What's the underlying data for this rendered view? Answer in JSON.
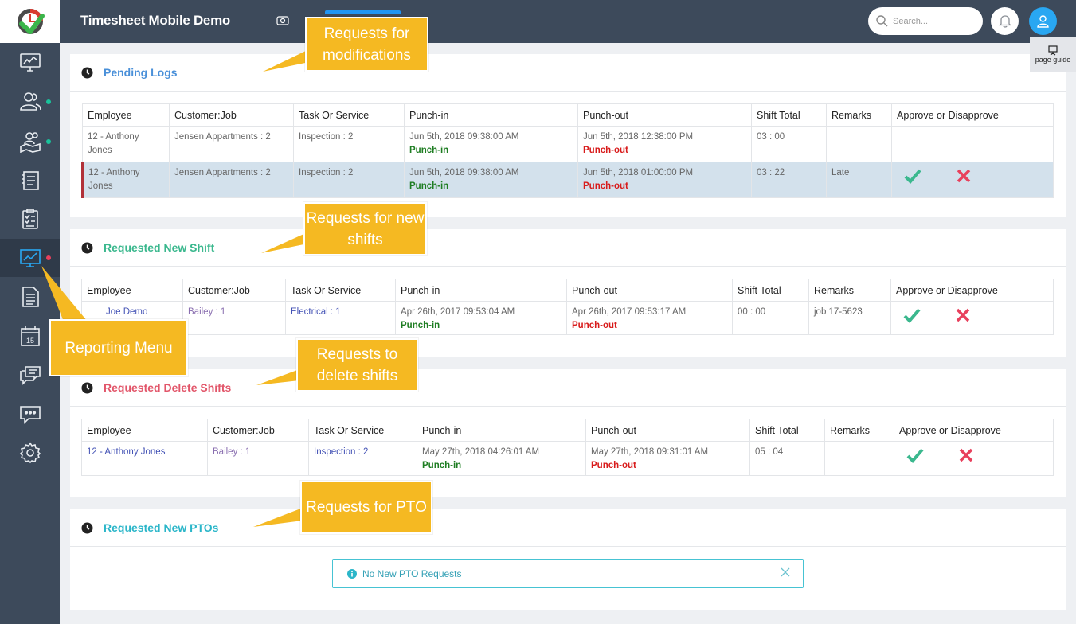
{
  "app": {
    "title": "Timesheet Mobile Demo"
  },
  "search": {
    "placeholder": "Search..."
  },
  "page_guide": {
    "label": "page guide"
  },
  "sidebar": {
    "items": [
      {
        "icon": "monitor-dashboard-icon"
      },
      {
        "icon": "users-icon",
        "dot": "#19c39b"
      },
      {
        "icon": "map-pin-users-icon",
        "dot": "#19c39b"
      },
      {
        "icon": "timesheet-icon"
      },
      {
        "icon": "clipboard-checklist-icon"
      },
      {
        "icon": "reporting-chart-icon",
        "dot": "#e8405c",
        "active": true
      },
      {
        "icon": "document-icon"
      },
      {
        "icon": "calendar-icon",
        "text": "15"
      },
      {
        "icon": "chat-icon"
      },
      {
        "icon": "message-dots-icon"
      },
      {
        "icon": "gear-icon"
      }
    ]
  },
  "pending_logs": {
    "title": "Pending Logs",
    "title_color": "#4a90d9",
    "headers": [
      "Employee",
      "Customer:Job",
      "Task Or Service",
      "Punch-in",
      "Punch-out",
      "Shift Total",
      "Remarks",
      "Approve or Disapprove"
    ],
    "rows": [
      {
        "employee": "12 - Anthony Jones",
        "job": "Jensen Appartments : 2",
        "task": "Inspection : 2",
        "punch_in": "Jun 5th, 2018 09:38:00 AM",
        "punch_in_label": "Punch-in",
        "punch_out": "Jun 5th, 2018 12:38:00 PM",
        "punch_out_label": "Punch-out",
        "total": "03 : 00",
        "remarks": ""
      },
      {
        "employee": "12 - Anthony Jones",
        "job": "Jensen Appartments : 2",
        "task": "Inspection : 2",
        "punch_in": "Jun 5th, 2018 09:38:00 AM",
        "punch_in_label": "Punch-in",
        "punch_out": "Jun 5th, 2018 01:00:00 PM",
        "punch_out_label": "Punch-out",
        "total": "03 : 22",
        "remarks": "Late"
      }
    ]
  },
  "new_shift": {
    "title": "Requested New Shift",
    "title_color": "#3bb88e",
    "headers": [
      "Employee",
      "Customer:Job",
      "Task Or Service",
      "Punch-in",
      "Punch-out",
      "Shift Total",
      "Remarks",
      "Approve or Disapprove"
    ],
    "rows": [
      {
        "employee": "Joe Demo",
        "job": "Bailey : 1",
        "task": "Electrical : 1",
        "punch_in": "Apr 26th, 2017 09:53:04 AM",
        "punch_in_label": "Punch-in",
        "punch_out": "Apr 26th, 2017 09:53:17 AM",
        "punch_out_label": "Punch-out",
        "total": "00 : 00",
        "remarks": "job 17-5623"
      }
    ]
  },
  "delete_shifts": {
    "title": "Requested Delete Shifts",
    "title_color": "#e2566a",
    "headers": [
      "Employee",
      "Customer:Job",
      "Task Or Service",
      "Punch-in",
      "Punch-out",
      "Shift Total",
      "Remarks",
      "Approve or Disapprove"
    ],
    "rows": [
      {
        "employee": "12 - Anthony Jones",
        "job": "Bailey : 1",
        "task": "Inspection : 2",
        "punch_in": "May 27th, 2018 04:26:01 AM",
        "punch_in_label": "Punch-in",
        "punch_out": "May 27th, 2018 09:31:01 AM",
        "punch_out_label": "Punch-out",
        "total": "05 : 04",
        "remarks": ""
      }
    ]
  },
  "new_ptos": {
    "title": "Requested New PTOs",
    "title_color": "#2bb6c9",
    "alert": "No New PTO Requests"
  },
  "callouts": {
    "modifications": "Requests for modifications",
    "new_shifts": "Requests for new shifts",
    "reporting_menu": "Reporting Menu",
    "delete_shifts": "Requests to delete shifts",
    "pto": "Requests for PTO"
  },
  "colors": {
    "accent_blue": "#29a7f2",
    "callout": "#f5b922",
    "approve": "#3bb88e",
    "disapprove": "#e8405c"
  }
}
